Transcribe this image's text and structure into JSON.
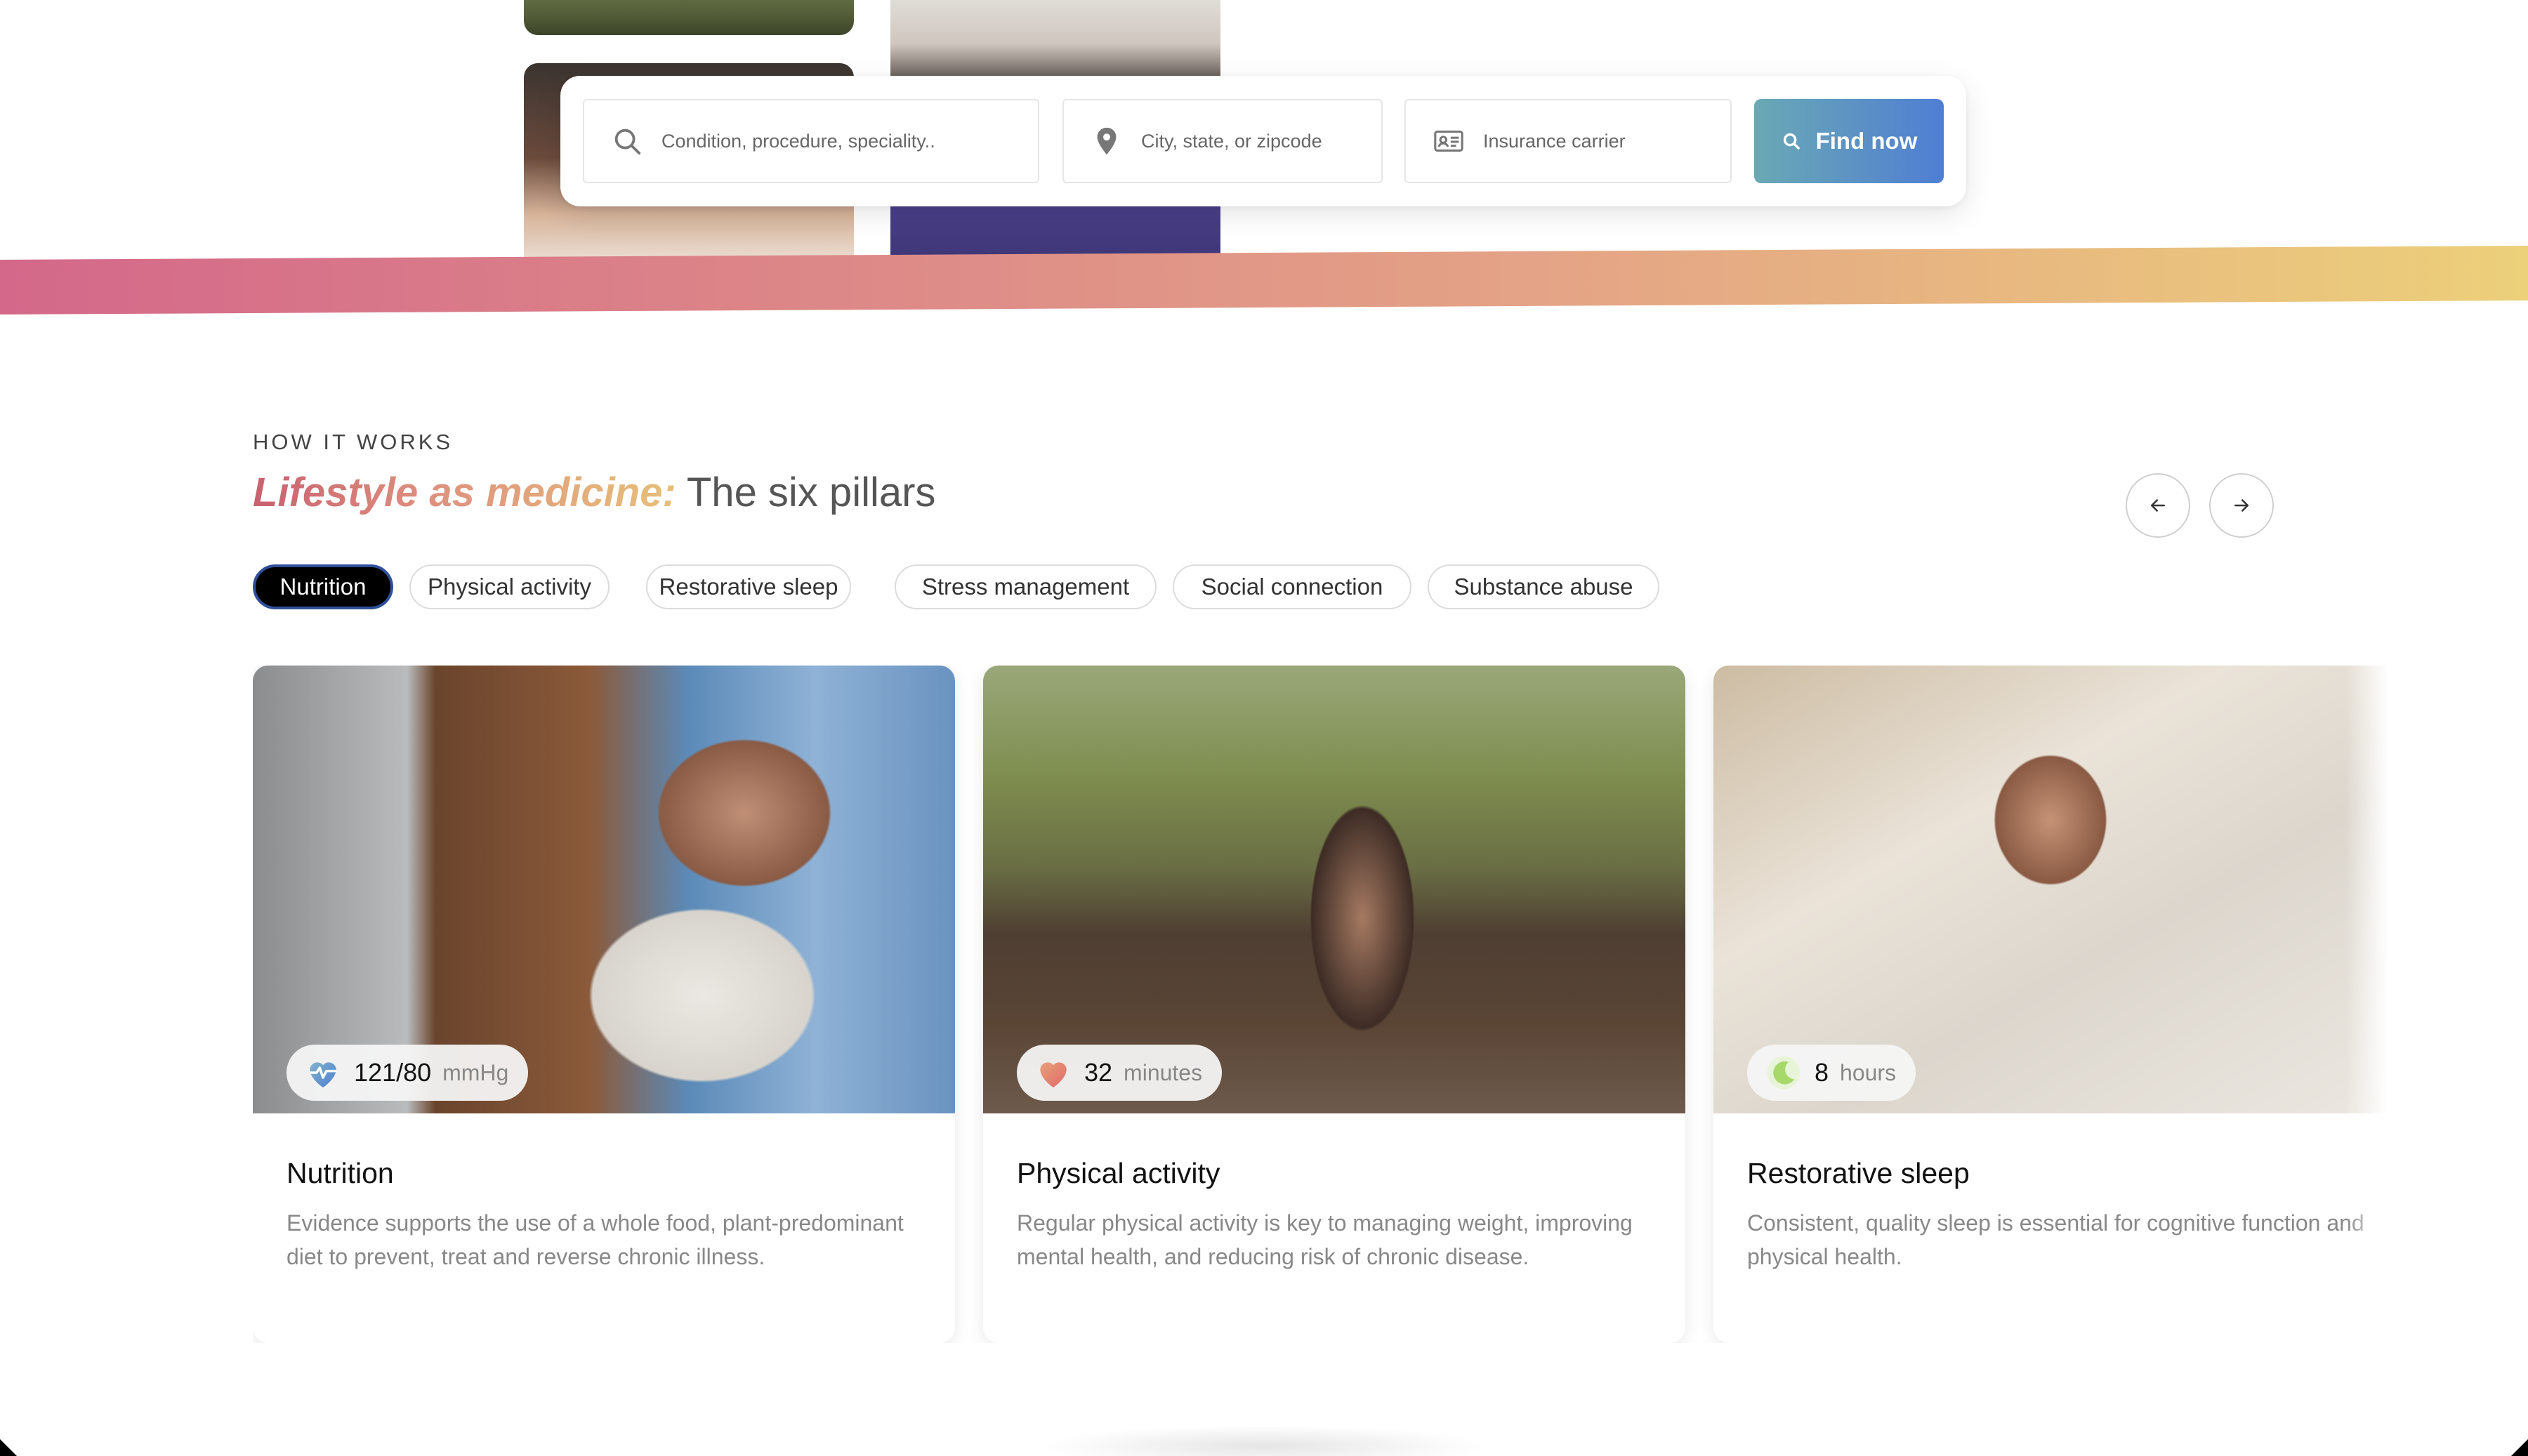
{
  "search": {
    "condition_placeholder": "Condition, procedure, speciality..",
    "location_placeholder": "City, state, or zipcode",
    "insurance_placeholder": "Insurance carrier",
    "find_label": "Find now",
    "button_gradient": [
      "#6aa9b4",
      "#4f7ed3"
    ]
  },
  "ribbon": {
    "colors": [
      "#d4688a",
      "#e4a286",
      "#ecd07a"
    ]
  },
  "section": {
    "eyebrow": "HOW IT WORKS",
    "headline_accent": "Lifestyle as medicine:",
    "headline_rest": " The six pillars",
    "prev_icon": "arrow-left-icon",
    "next_icon": "arrow-right-icon"
  },
  "pills": [
    {
      "label": "Nutrition",
      "active": true
    },
    {
      "label": "Physical activity",
      "active": false
    },
    {
      "label": "Restorative sleep",
      "active": false
    },
    {
      "label": "Stress management",
      "active": false
    },
    {
      "label": "Social connection",
      "active": false
    },
    {
      "label": "Substance abuse",
      "active": false
    }
  ],
  "cards": [
    {
      "title": "Nutrition",
      "description": "Evidence supports the use of a whole food, plant-predominant diet to prevent, treat and reverse chronic illness.",
      "badge_value": "121/80",
      "badge_unit": "mmHg",
      "badge_icon": "heart-pulse-icon"
    },
    {
      "title": "Physical activity",
      "description": "Regular physical activity is key to managing weight, improving mental health, and reducing risk of chronic disease.",
      "badge_value": "32",
      "badge_unit": "minutes",
      "badge_icon": "heart-icon"
    },
    {
      "title": "Restorative sleep",
      "description": "Consistent, quality sleep is essential for cognitive function and physical health.",
      "badge_value": "8",
      "badge_unit": "hours",
      "badge_icon": "moon-icon"
    }
  ]
}
